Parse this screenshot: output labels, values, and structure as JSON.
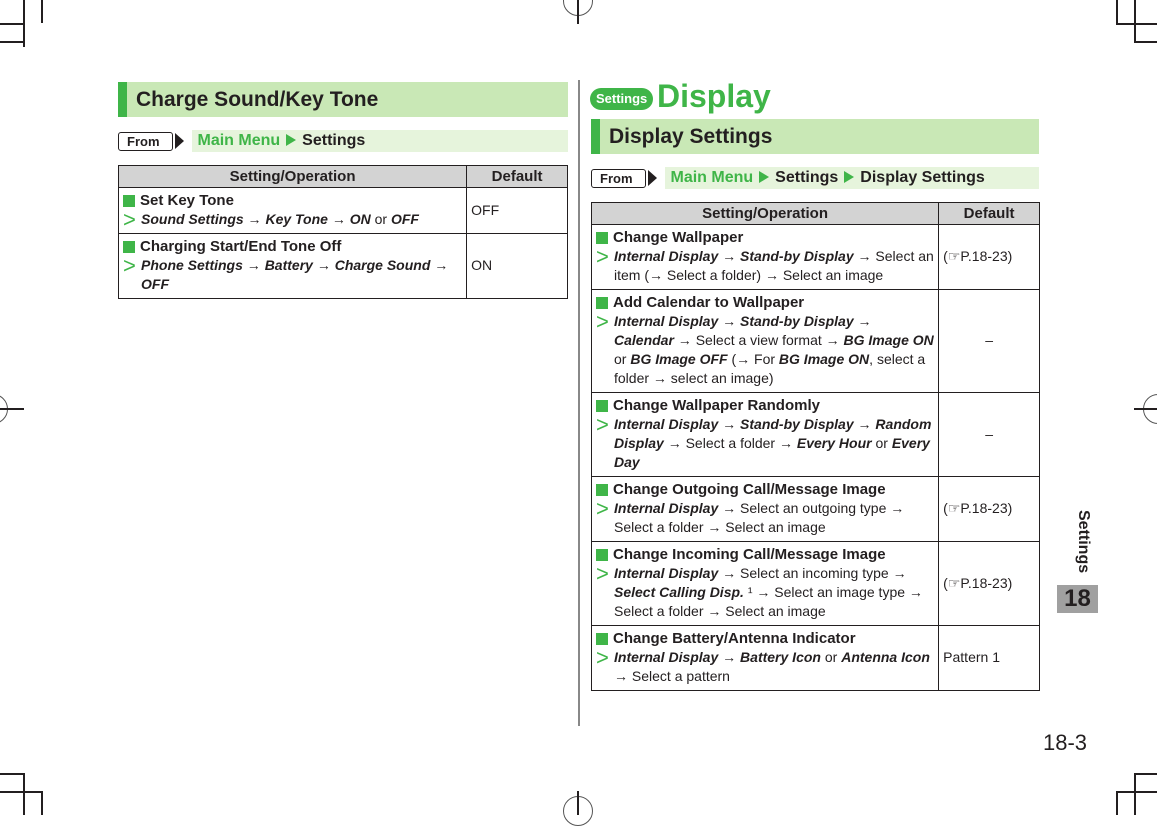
{
  "left_section": {
    "title": "Charge Sound/Key Tone",
    "from_label": "From",
    "path": [
      "Main Menu",
      "Settings"
    ],
    "table": {
      "headers": [
        "Setting/Operation",
        "Default"
      ],
      "rows": [
        {
          "title": "Set Key Tone",
          "op": [
            {
              "t": "Sound Settings",
              "s": "bi"
            },
            {
              "t": " → ",
              "s": ""
            },
            {
              "t": "Key Tone",
              "s": "bi"
            },
            {
              "t": " → ",
              "s": ""
            },
            {
              "t": "ON",
              "s": "bi"
            },
            {
              "t": " or ",
              "s": ""
            },
            {
              "t": "OFF",
              "s": "bi"
            }
          ],
          "default": "OFF"
        },
        {
          "title": "Charging Start/End Tone Off",
          "op": [
            {
              "t": "Phone Settings",
              "s": "bi"
            },
            {
              "t": " → ",
              "s": ""
            },
            {
              "t": "Battery",
              "s": "bi"
            },
            {
              "t": " → ",
              "s": ""
            },
            {
              "t": "Charge Sound",
              "s": "bi"
            },
            {
              "t": " → ",
              "s": ""
            },
            {
              "t": "OFF",
              "s": "bi"
            }
          ],
          "default": "ON"
        }
      ]
    }
  },
  "right_section": {
    "category_pill": "Settings",
    "page_title": "Display",
    "title": "Display Settings",
    "from_label": "From",
    "path": [
      "Main Menu",
      "Settings",
      "Display Settings"
    ],
    "table": {
      "headers": [
        "Setting/Operation",
        "Default"
      ],
      "rows": [
        {
          "title": "Change Wallpaper",
          "op": [
            {
              "t": "Internal Display",
              "s": "bi"
            },
            {
              "t": " → ",
              "s": ""
            },
            {
              "t": "Stand-by Display",
              "s": "bi"
            },
            {
              "t": " → Select an item (→ Select a folder) → Select an image",
              "s": ""
            }
          ],
          "default": "(☞P.18-23)",
          "center": false
        },
        {
          "title": "Add Calendar to Wallpaper",
          "op": [
            {
              "t": "Internal Display",
              "s": "bi"
            },
            {
              "t": " → ",
              "s": ""
            },
            {
              "t": "Stand-by Display",
              "s": "bi"
            },
            {
              "t": " → ",
              "s": ""
            },
            {
              "t": "Calendar",
              "s": "bi"
            },
            {
              "t": " → Select a view format → ",
              "s": ""
            },
            {
              "t": "BG Image ON",
              "s": "bi"
            },
            {
              "t": " or ",
              "s": ""
            },
            {
              "t": "BG Image OFF",
              "s": "bi"
            },
            {
              "t": " (→ For ",
              "s": ""
            },
            {
              "t": "BG Image ON",
              "s": "bi"
            },
            {
              "t": ", select a folder → select an image)",
              "s": ""
            }
          ],
          "default": "–",
          "center": true
        },
        {
          "title": "Change Wallpaper Randomly",
          "op": [
            {
              "t": "Internal Display",
              "s": "bi"
            },
            {
              "t": " → ",
              "s": ""
            },
            {
              "t": "Stand-by Display",
              "s": "bi"
            },
            {
              "t": " → ",
              "s": ""
            },
            {
              "t": "Random Display",
              "s": "bi"
            },
            {
              "t": " → Select a folder → ",
              "s": ""
            },
            {
              "t": "Every Hour",
              "s": "bi"
            },
            {
              "t": " or ",
              "s": ""
            },
            {
              "t": "Every Day",
              "s": "bi"
            }
          ],
          "default": "–",
          "center": true
        },
        {
          "title": "Change Outgoing Call/Message Image",
          "op": [
            {
              "t": "Internal Display",
              "s": "bi"
            },
            {
              "t": " → Select an outgoing type → Select a folder → Select an image",
              "s": ""
            }
          ],
          "default": "(☞P.18-23)",
          "center": false
        },
        {
          "title": "Change Incoming Call/Message Image",
          "op": [
            {
              "t": "Internal Display",
              "s": "bi"
            },
            {
              "t": " → Select an incoming type → ",
              "s": ""
            },
            {
              "t": "Select Calling Disp.",
              "s": "bi"
            },
            {
              "t": " ¹ → Select an image type → Select a folder → Select an image",
              "s": ""
            }
          ],
          "default": "(☞P.18-23)",
          "center": false
        },
        {
          "title": "Change Battery/Antenna Indicator",
          "op": [
            {
              "t": "Internal Display",
              "s": "bi"
            },
            {
              "t": " → ",
              "s": ""
            },
            {
              "t": "Battery Icon",
              "s": "bi"
            },
            {
              "t": " or ",
              "s": ""
            },
            {
              "t": "Antenna Icon",
              "s": "bi"
            },
            {
              "t": " → Select a pattern",
              "s": ""
            }
          ],
          "default": "Pattern 1",
          "center": false
        }
      ]
    }
  },
  "side_tab": {
    "label": "Settings",
    "chapter": "18"
  },
  "page_number": "18-3",
  "colors": {
    "accent_green": "#3fb548",
    "header_bg": "#c9e8b6",
    "path_bg": "#e6f4dc",
    "table_head_bg": "#d3d3d3"
  }
}
